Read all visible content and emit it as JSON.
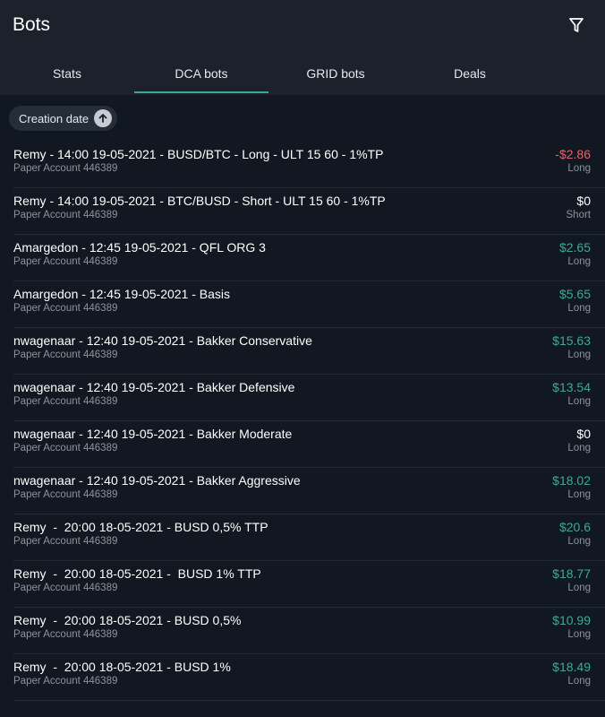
{
  "header": {
    "title": "Bots",
    "filter_icon": "filter-icon"
  },
  "tabs": [
    {
      "label": "Stats",
      "active": false
    },
    {
      "label": "DCA bots",
      "active": true
    },
    {
      "label": "GRID bots",
      "active": false
    },
    {
      "label": "Deals",
      "active": false
    }
  ],
  "sort": {
    "label": "Creation date",
    "direction_icon": "arrow-up-icon"
  },
  "colors": {
    "positive": "#3fa79a",
    "negative": "#e5636b",
    "neutral": "#ffffff",
    "accent": "#3fa79a"
  },
  "bots": [
    {
      "name": "Remy - 14:00 19-05-2021 - BUSD/BTC - Long - ULT 15 60 - 1%TP",
      "account": "Paper Account 446389",
      "pnl": "-$2.86",
      "status": "negative",
      "side": "Long"
    },
    {
      "name": "Remy - 14:00 19-05-2021 - BTC/BUSD - Short - ULT 15 60 - 1%TP",
      "account": "Paper Account 446389",
      "pnl": "$0",
      "status": "neutral",
      "side": "Short"
    },
    {
      "name": "Amargedon - 12:45 19-05-2021 - QFL ORG 3",
      "account": "Paper Account 446389",
      "pnl": "$2.65",
      "status": "positive",
      "side": "Long"
    },
    {
      "name": "Amargedon - 12:45 19-05-2021 - Basis",
      "account": "Paper Account 446389",
      "pnl": "$5.65",
      "status": "positive",
      "side": "Long"
    },
    {
      "name": "nwagenaar - 12:40 19-05-2021 - Bakker Conservative",
      "account": "Paper Account 446389",
      "pnl": "$15.63",
      "status": "positive",
      "side": "Long"
    },
    {
      "name": "nwagenaar - 12:40 19-05-2021 - Bakker Defensive",
      "account": "Paper Account 446389",
      "pnl": "$13.54",
      "status": "positive",
      "side": "Long"
    },
    {
      "name": "nwagenaar - 12:40 19-05-2021 - Bakker Moderate",
      "account": "Paper Account 446389",
      "pnl": "$0",
      "status": "neutral",
      "side": "Long"
    },
    {
      "name": "nwagenaar - 12:40 19-05-2021 - Bakker Aggressive",
      "account": "Paper Account 446389",
      "pnl": "$18.02",
      "status": "positive",
      "side": "Long"
    },
    {
      "name": "Remy  -  20:00 18-05-2021 - BUSD 0,5% TTP",
      "account": "Paper Account 446389",
      "pnl": "$20.6",
      "status": "positive",
      "side": "Long"
    },
    {
      "name": "Remy  -  20:00 18-05-2021 -  BUSD 1% TTP",
      "account": "Paper Account 446389",
      "pnl": "$18.77",
      "status": "positive",
      "side": "Long"
    },
    {
      "name": "Remy  -  20:00 18-05-2021 - BUSD 0,5%",
      "account": "Paper Account 446389",
      "pnl": "$10.99",
      "status": "positive",
      "side": "Long"
    },
    {
      "name": "Remy  -  20:00 18-05-2021 - BUSD 1%",
      "account": "Paper Account 446389",
      "pnl": "$18.49",
      "status": "positive",
      "side": "Long"
    }
  ]
}
